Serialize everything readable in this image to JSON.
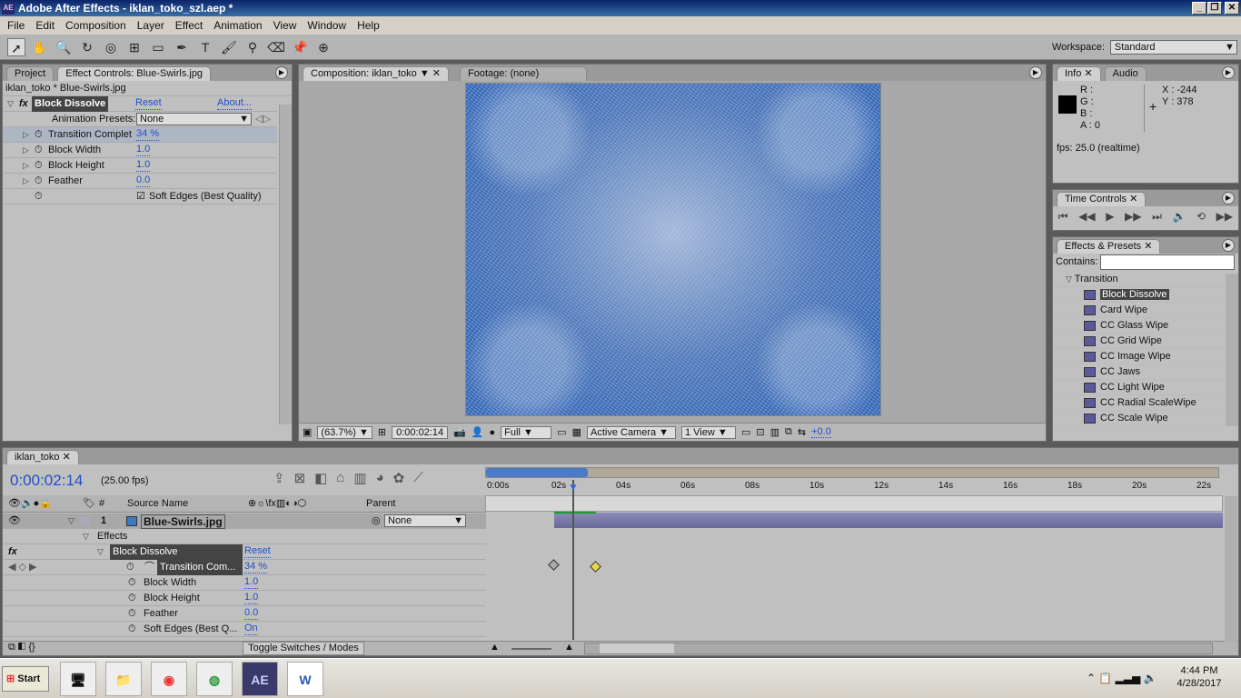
{
  "window": {
    "title": "Adobe After Effects - iklan_toko_szl.aep *",
    "app_icon": "AE"
  },
  "menu": [
    "File",
    "Edit",
    "Composition",
    "Layer",
    "Effect",
    "Animation",
    "View",
    "Window",
    "Help"
  ],
  "workspace": {
    "label": "Workspace:",
    "value": "Standard"
  },
  "left_panel": {
    "tabs": [
      "Project",
      "Effect Controls: Blue-Swirls.jpg"
    ],
    "breadcrumb": "iklan_toko * Blue-Swirls.jpg",
    "effect_name": "Block Dissolve",
    "reset": "Reset",
    "about": "About...",
    "presets_label": "Animation Presets:",
    "presets_value": "None",
    "params": [
      {
        "name": "Transition Complet",
        "value": "34 %"
      },
      {
        "name": "Block Width",
        "value": "1.0"
      },
      {
        "name": "Block Height",
        "value": "1.0"
      },
      {
        "name": "Feather",
        "value": "0.0"
      }
    ],
    "soft_edges": "Soft Edges (Best Quality)"
  },
  "comp_panel": {
    "tabs": [
      "Composition: iklan_toko",
      "Footage: (none)"
    ],
    "zoom": "(63.7%)",
    "time": "0:00:02:14",
    "resolution": "Full",
    "camera": "Active Camera",
    "views": "1 View",
    "exposure": "+0.0"
  },
  "info": {
    "tabs": [
      "Info",
      "Audio"
    ],
    "r": "R :",
    "g": "G :",
    "b": "B :",
    "a": "A : 0",
    "x": "X : -244",
    "y": "Y : 378",
    "fps": "fps: 25.0 (realtime)"
  },
  "time_controls": {
    "tab": "Time Controls"
  },
  "effects_presets": {
    "tab": "Effects & Presets",
    "contains_label": "Contains:",
    "category": "Transition",
    "items": [
      "Block Dissolve",
      "Card Wipe",
      "CC Glass Wipe",
      "CC Grid Wipe",
      "CC Image Wipe",
      "CC Jaws",
      "CC Light Wipe",
      "CC Radial ScaleWipe",
      "CC Scale Wipe"
    ]
  },
  "timeline": {
    "tab": "iklan_toko",
    "timecode": "0:00:02:14",
    "fps": "(25.00 fps)",
    "col_num": "#",
    "col_source": "Source Name",
    "col_parent": "Parent",
    "layer": {
      "num": "1",
      "name": "Blue-Swirls.jpg",
      "parent": "None"
    },
    "effects_label": "Effects",
    "effect": "Block Dissolve",
    "reset": "Reset",
    "props": [
      {
        "name": "Transition Com...",
        "value": "34 %"
      },
      {
        "name": "Block Width",
        "value": "1.0"
      },
      {
        "name": "Block Height",
        "value": "1.0"
      },
      {
        "name": "Feather",
        "value": "0.0"
      },
      {
        "name": "Soft Edges (Best Q...",
        "value": "On"
      }
    ],
    "toggle": "Toggle Switches / Modes",
    "ticks": [
      "0:00s",
      "02s",
      "04s",
      "06s",
      "08s",
      "10s",
      "12s",
      "14s",
      "16s",
      "18s",
      "20s",
      "22s"
    ]
  },
  "taskbar": {
    "start": "Start",
    "apps": [
      "computer",
      "explorer",
      "app",
      "chrome",
      "AE",
      "W"
    ],
    "time": "4:44 PM",
    "date": "4/28/2017"
  }
}
